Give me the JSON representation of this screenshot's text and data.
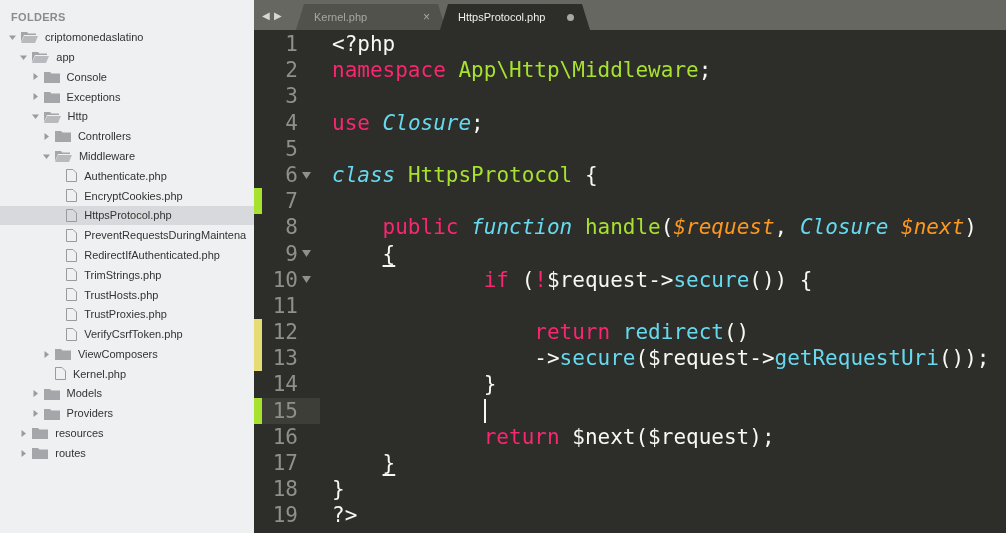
{
  "sidebar": {
    "title": "FOLDERS",
    "tree": [
      {
        "name": "criptomonedaslatino",
        "kind": "folder",
        "expanded": true,
        "selected": false,
        "children": [
          {
            "name": "app",
            "kind": "folder",
            "expanded": true,
            "selected": false,
            "children": [
              {
                "name": "Console",
                "kind": "folder",
                "expanded": false,
                "selected": false
              },
              {
                "name": "Exceptions",
                "kind": "folder",
                "expanded": false,
                "selected": false
              },
              {
                "name": "Http",
                "kind": "folder",
                "expanded": true,
                "selected": false,
                "children": [
                  {
                    "name": "Controllers",
                    "kind": "folder",
                    "expanded": false,
                    "selected": false
                  },
                  {
                    "name": "Middleware",
                    "kind": "folder",
                    "expanded": true,
                    "selected": false,
                    "children": [
                      {
                        "name": "Authenticate.php",
                        "kind": "file",
                        "selected": false
                      },
                      {
                        "name": "EncryptCookies.php",
                        "kind": "file",
                        "selected": false
                      },
                      {
                        "name": "HttpsProtocol.php",
                        "kind": "file",
                        "selected": true
                      },
                      {
                        "name": "PreventRequestsDuringMaintena",
                        "kind": "file",
                        "selected": false
                      },
                      {
                        "name": "RedirectIfAuthenticated.php",
                        "kind": "file",
                        "selected": false
                      },
                      {
                        "name": "TrimStrings.php",
                        "kind": "file",
                        "selected": false
                      },
                      {
                        "name": "TrustHosts.php",
                        "kind": "file",
                        "selected": false
                      },
                      {
                        "name": "TrustProxies.php",
                        "kind": "file",
                        "selected": false
                      },
                      {
                        "name": "VerifyCsrfToken.php",
                        "kind": "file",
                        "selected": false
                      }
                    ]
                  },
                  {
                    "name": "ViewComposers",
                    "kind": "folder",
                    "expanded": false,
                    "selected": false
                  },
                  {
                    "name": "Kernel.php",
                    "kind": "file",
                    "selected": false
                  }
                ]
              },
              {
                "name": "Models",
                "kind": "folder",
                "expanded": false,
                "selected": false
              },
              {
                "name": "Providers",
                "kind": "folder",
                "expanded": false,
                "selected": false
              }
            ]
          },
          {
            "name": "resources",
            "kind": "folder",
            "expanded": false,
            "selected": false
          },
          {
            "name": "routes",
            "kind": "folder",
            "expanded": false,
            "selected": false
          }
        ]
      }
    ]
  },
  "tabs": {
    "nav": [
      "◀",
      "▶"
    ],
    "items": [
      {
        "label": "Kernel.php",
        "selected": false,
        "modified": false,
        "close": "×"
      },
      {
        "label": "HttpsProtocol.php",
        "selected": true,
        "modified": true
      }
    ]
  },
  "editor": {
    "lines": [
      {
        "number": "1",
        "tokens": [
          {
            "text": "<?php",
            "kind": "plain"
          }
        ]
      },
      {
        "number": "2",
        "tokens": [
          {
            "text": "namespace",
            "kind": "keyword"
          },
          {
            "text": " App\\Http\\Middleware",
            "kind": "entity"
          },
          {
            "text": ";",
            "kind": "plain"
          }
        ]
      },
      {
        "number": "3"
      },
      {
        "number": "4",
        "tokens": [
          {
            "text": "use",
            "kind": "keyword"
          },
          {
            "text": " Closure",
            "kind": "storage"
          },
          {
            "text": ";",
            "kind": "plain"
          }
        ]
      },
      {
        "number": "5"
      },
      {
        "number": "6",
        "foldable": true,
        "tokens": [
          {
            "text": "class",
            "kind": "storage"
          },
          {
            "text": " HttpsProtocol",
            "kind": "entity"
          },
          {
            "text": " {",
            "kind": "plain"
          }
        ]
      },
      {
        "number": "7",
        "added": true
      },
      {
        "number": "8",
        "tokens": [
          {
            "text": "    public",
            "kind": "keyword"
          },
          {
            "text": " function",
            "kind": "storage"
          },
          {
            "text": " handle",
            "kind": "entity"
          },
          {
            "text": "(",
            "kind": "plain"
          },
          {
            "text": "$request",
            "kind": "variable"
          },
          {
            "text": ",",
            "kind": "plain"
          },
          {
            "text": " Closure",
            "kind": "storage"
          },
          {
            "text": " $next",
            "kind": "variable"
          },
          {
            "text": ")",
            "kind": "plain"
          }
        ]
      },
      {
        "number": "9",
        "foldable": true,
        "tokens": [
          {
            "text": "    {",
            "kind": "bracket"
          }
        ]
      },
      {
        "number": "10",
        "foldable": true,
        "tokens": [
          {
            "text": "            if",
            "kind": "keyword"
          },
          {
            "text": " (",
            "kind": "plain"
          },
          {
            "text": "!",
            "kind": "keyword"
          },
          {
            "text": "$request->",
            "kind": "plain"
          },
          {
            "text": "secure",
            "kind": "call"
          },
          {
            "text": "()) {",
            "kind": "plain"
          }
        ]
      },
      {
        "number": "11"
      },
      {
        "number": "12",
        "modified": true,
        "tokens": [
          {
            "text": "                return",
            "kind": "keyword"
          },
          {
            "text": " redirect",
            "kind": "call"
          },
          {
            "text": "()",
            "kind": "plain"
          }
        ]
      },
      {
        "number": "13",
        "modified": true,
        "tokens": [
          {
            "text": "                ->",
            "kind": "plain"
          },
          {
            "text": "secure",
            "kind": "call"
          },
          {
            "text": "($request->",
            "kind": "plain"
          },
          {
            "text": "getRequestUri",
            "kind": "call"
          },
          {
            "text": "());",
            "kind": "plain"
          }
        ]
      },
      {
        "number": "14",
        "tokens": [
          {
            "text": "            }",
            "kind": "plain"
          }
        ]
      },
      {
        "number": "15",
        "added": true,
        "current": true,
        "cursor": true
      },
      {
        "number": "16",
        "tokens": [
          {
            "text": "            return",
            "kind": "keyword"
          },
          {
            "text": " $next($request);",
            "kind": "plain"
          }
        ]
      },
      {
        "number": "17",
        "tokens": [
          {
            "text": "    }",
            "kind": "bracket"
          }
        ]
      },
      {
        "number": "18",
        "tokens": [
          {
            "text": "}",
            "kind": "plain"
          }
        ]
      },
      {
        "number": "19",
        "tokens": [
          {
            "text": "?>",
            "kind": "plain"
          }
        ]
      }
    ]
  }
}
